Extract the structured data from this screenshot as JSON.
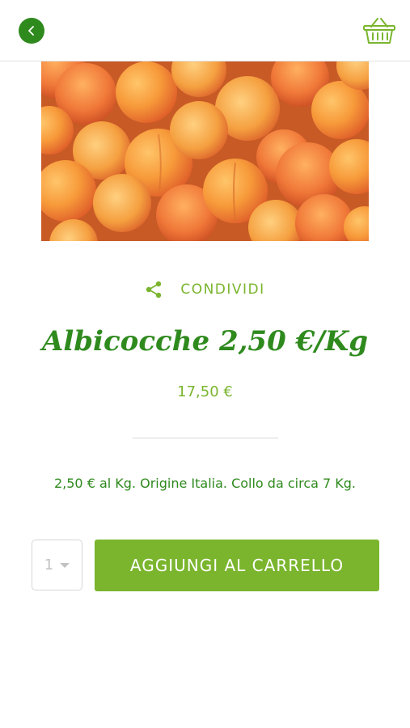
{
  "header": {
    "back_icon": "chevron-left-icon",
    "cart_icon": "basket-icon"
  },
  "product": {
    "image_alt": "Albicocche",
    "share_label": "CONDIVIDI",
    "title": "Albicocche 2,50 €/Kg",
    "price": "17,50 €",
    "description": "2,50 € al Kg. Origine Italia. Collo da circa 7 Kg."
  },
  "purchase": {
    "quantity": "1",
    "add_to_cart_label": "AGGIUNGI AL CARRELLO"
  },
  "colors": {
    "primary_green": "#2f8a1e",
    "accent_green": "#7ab52d",
    "white": "#ffffff"
  }
}
